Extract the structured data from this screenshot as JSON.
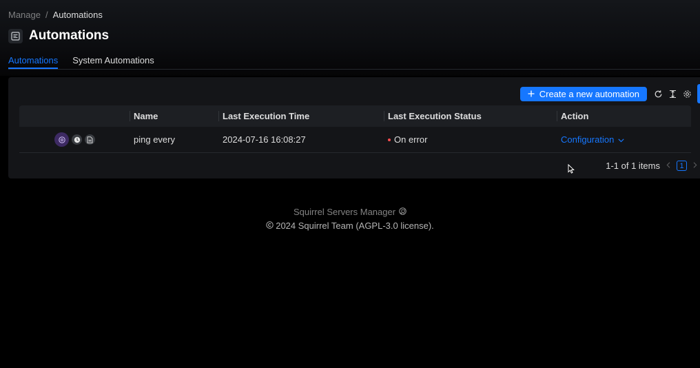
{
  "breadcrumb": {
    "parent": "Manage",
    "separator": "/",
    "current": "Automations"
  },
  "page": {
    "title": "Automations",
    "icon": "automation-icon"
  },
  "tabs": [
    {
      "label": "Automations",
      "active": true
    },
    {
      "label": "System Automations",
      "active": false
    }
  ],
  "toolbar": {
    "create_label": "Create a new automation",
    "icons": [
      "reload-icon",
      "column-height-icon",
      "settings-icon"
    ]
  },
  "table": {
    "columns": [
      "",
      "Name",
      "Last Execution Time",
      "Last Execution Status",
      "Action"
    ],
    "rows": [
      {
        "icons": [
          "robot-icon",
          "clock-icon",
          "file-icon"
        ],
        "name": "ping every",
        "last_execution_time": "2024-07-16 16:08:27",
        "last_execution_status": "On error",
        "action": "Configuration"
      }
    ]
  },
  "pagination": {
    "summary": "1-1 of 1 items",
    "current_page": "1"
  },
  "footer": {
    "app_name": "Squirrel Servers Manager",
    "copyright": "2024 Squirrel Team (AGPL-3.0 license)."
  },
  "colors": {
    "accent": "#1677ff",
    "error": "#ff4d4f",
    "background": "#000000",
    "panel": "#141518"
  }
}
